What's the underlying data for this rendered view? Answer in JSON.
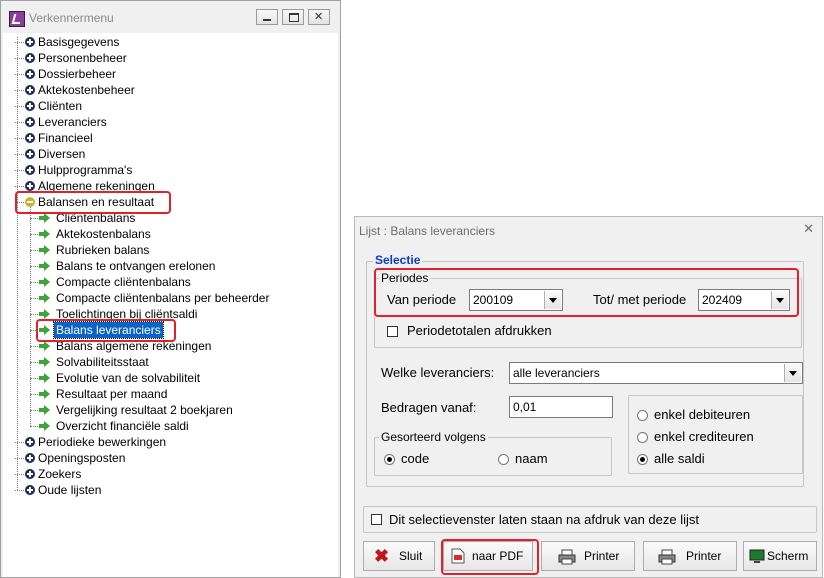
{
  "explorer": {
    "title": "Verkennermenu",
    "items": [
      {
        "label": "Basisgegevens",
        "level": 0,
        "icon": "plus"
      },
      {
        "label": "Personenbeheer",
        "level": 0,
        "icon": "plus"
      },
      {
        "label": "Dossierbeheer",
        "level": 0,
        "icon": "plus"
      },
      {
        "label": "Aktekostenbeheer",
        "level": 0,
        "icon": "plus"
      },
      {
        "label": "Cliënten",
        "level": 0,
        "icon": "plus"
      },
      {
        "label": "Leveranciers",
        "level": 0,
        "icon": "plus"
      },
      {
        "label": "Financieel",
        "level": 0,
        "icon": "plus"
      },
      {
        "label": "Diversen",
        "level": 0,
        "icon": "plus"
      },
      {
        "label": "Hulpprogramma's",
        "level": 0,
        "icon": "plus"
      },
      {
        "label": "Algemene rekeningen",
        "level": 0,
        "icon": "plus"
      },
      {
        "label": "Balansen en resultaat",
        "level": 0,
        "icon": "minus"
      },
      {
        "label": "Cliëntenbalans",
        "level": 1,
        "icon": "arrow"
      },
      {
        "label": "Aktekostenbalans",
        "level": 1,
        "icon": "arrow"
      },
      {
        "label": "Rubrieken balans",
        "level": 1,
        "icon": "arrow"
      },
      {
        "label": "Balans te ontvangen erelonen",
        "level": 1,
        "icon": "arrow"
      },
      {
        "label": "Compacte cliëntenbalans",
        "level": 1,
        "icon": "arrow"
      },
      {
        "label": "Compacte cliëntenbalans per beheerder",
        "level": 1,
        "icon": "arrow"
      },
      {
        "label": "Toelichtingen bij cliëntsaldi",
        "level": 1,
        "icon": "arrow"
      },
      {
        "label": "Balans leveranciers",
        "level": 1,
        "icon": "arrow",
        "selected": true
      },
      {
        "label": "Balans algemene rekeningen",
        "level": 1,
        "icon": "arrow"
      },
      {
        "label": "Solvabiliteitsstaat",
        "level": 1,
        "icon": "arrow"
      },
      {
        "label": "Evolutie van de solvabiliteit",
        "level": 1,
        "icon": "arrow"
      },
      {
        "label": "Resultaat per maand",
        "level": 1,
        "icon": "arrow"
      },
      {
        "label": "Vergelijking resultaat 2 boekjaren",
        "level": 1,
        "icon": "arrow"
      },
      {
        "label": "Overzicht financiële saldi",
        "level": 1,
        "icon": "arrow"
      },
      {
        "label": "Periodieke bewerkingen",
        "level": 0,
        "icon": "plus"
      },
      {
        "label": "Openingsposten",
        "level": 0,
        "icon": "plus"
      },
      {
        "label": "Zoekers",
        "level": 0,
        "icon": "plus"
      },
      {
        "label": "Oude lijsten",
        "level": 0,
        "icon": "plus"
      }
    ]
  },
  "dialog": {
    "title": "Lijst : Balans leveranciers",
    "selectie_legend": "Selectie",
    "periodes_legend": "Periodes",
    "van_label": "Van periode",
    "van_value": "200109",
    "tot_label": "Tot/ met periode",
    "tot_value": "202409",
    "periodetotalen_label": "Periodetotalen afdrukken",
    "welke_label": "Welke leveranciers:",
    "welke_value": "alle leveranciers",
    "bedragen_label": "Bedragen vanaf:",
    "bedragen_value": "0,01",
    "gesorteerd_legend": "Gesorteerd volgens",
    "sort_options": [
      "code",
      "naam"
    ],
    "saldi_options": [
      "enkel debiteuren",
      "enkel crediteuren",
      "alle saldi"
    ],
    "keep_window_label": "Dit selectievenster laten staan na afdruk van deze lijst",
    "buttons": {
      "sluit": "Sluit",
      "pdf": "naar PDF",
      "printer1": "Printer",
      "printer2": "Printer",
      "scherm": "Scherm"
    }
  }
}
